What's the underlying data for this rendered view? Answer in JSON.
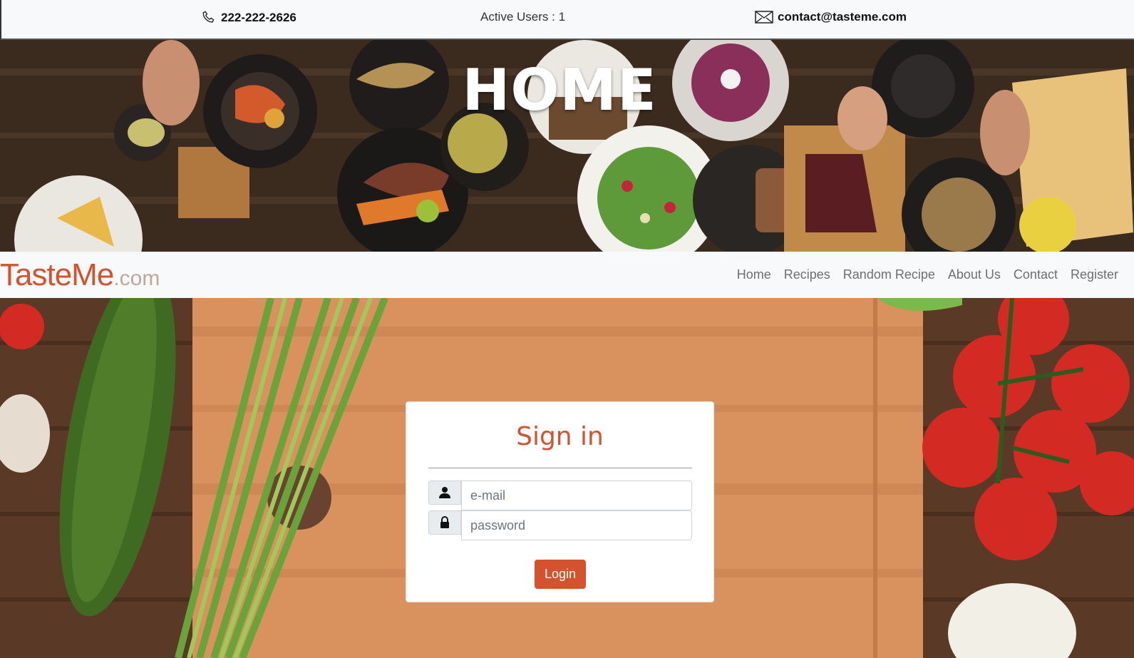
{
  "topbar": {
    "phone": "222-222-2626",
    "active_users": "Active Users : 1",
    "email": "contact@tasteme.com",
    "icons": {
      "phone": "phone-icon",
      "mail": "envelope-icon"
    }
  },
  "hero": {
    "title": "HOME"
  },
  "navbar": {
    "logo_brand": "TasteMe",
    "logo_domain": ".com",
    "links": [
      "Home",
      "Recipes",
      "Random Recipe",
      "About Us",
      "Contact",
      "Register"
    ]
  },
  "signin": {
    "heading": "Sign in",
    "email_placeholder": "e-mail",
    "password_placeholder": "password",
    "login_label": "Login",
    "icons": {
      "email": "user-icon",
      "password": "lock-icon"
    }
  },
  "colors": {
    "accent": "#d4532e",
    "nav_bg": "#f8f9fb"
  }
}
